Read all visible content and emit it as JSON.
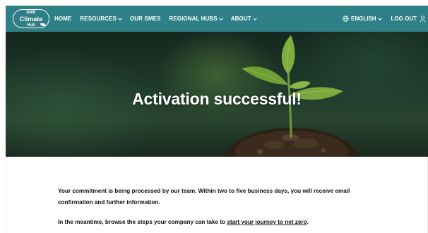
{
  "nav": {
    "logo": {
      "line1": "SME",
      "line2": "Climate",
      "line3": "Hub"
    },
    "items": [
      {
        "label": "HOME",
        "dropdown": false
      },
      {
        "label": "RESOURCES",
        "dropdown": true
      },
      {
        "label": "OUR SMES",
        "dropdown": false
      },
      {
        "label": "REGIONAL HUBS",
        "dropdown": true
      },
      {
        "label": "ABOUT",
        "dropdown": true
      }
    ],
    "language": "ENGLISH",
    "logout": "LOG OUT",
    "background_color": "#2e7f86"
  },
  "hero": {
    "title": "Activation successful!"
  },
  "content": {
    "paragraph1": "Your commitment is being processed by our team. Within two to five business days, you will receive email confirmation and further information.",
    "paragraph2_prefix": "In the meantime, browse the steps your company can take to ",
    "paragraph2_link": "start your journey to net zero",
    "paragraph2_suffix": "."
  }
}
